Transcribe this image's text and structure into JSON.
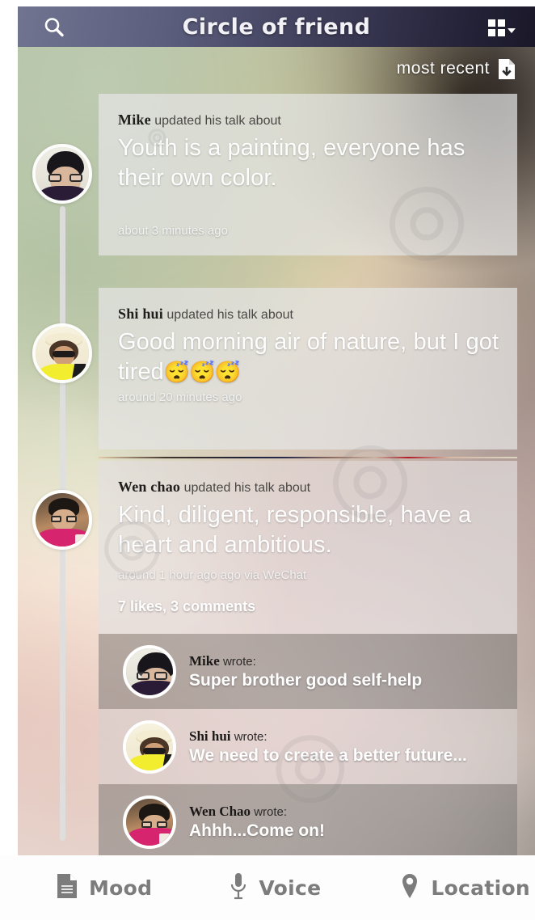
{
  "header": {
    "title": "Circle of friend",
    "search_icon": "search-icon",
    "grid_icon": "grid-menu-icon",
    "bar_color": "#3b3a55"
  },
  "sort": {
    "label": "most  recent",
    "icon": "document-download-icon"
  },
  "posts": [
    {
      "name": "Mike",
      "action": "updated his talk about",
      "message": "Youth is a painting, everyone has their own color.",
      "emoji": "",
      "time": "about 3 minutes ago",
      "avatar": "avatar-mike"
    },
    {
      "name": "Shi hui",
      "action": "updated his talk about",
      "message": "Good morning air of nature, but I got tired",
      "emoji": "😴😴😴",
      "time": "around 20 minutes ago",
      "avatar": "avatar-shi-hui"
    },
    {
      "name": "Wen chao",
      "action": "updated his talk about",
      "message": "Kind, diligent, responsible, have a heart and ambitious.",
      "emoji": "",
      "time": "around 1 hour ago ago via WeChat",
      "stats": "7 likes, 3 comments",
      "avatar": "avatar-wen-chao"
    }
  ],
  "comments": [
    {
      "name": "Mike",
      "action": "wrote:",
      "text": "Super brother good self-help",
      "avatar": "avatar-mike"
    },
    {
      "name": "Shi hui",
      "action": "wrote:",
      "text": "We need to create a better future...",
      "avatar": "avatar-shi-hui"
    },
    {
      "name": "Wen Chao",
      "action": "wrote:",
      "text": "Ahhh...Come on!",
      "avatar": "avatar-wen-chao"
    }
  ],
  "bottombar": [
    {
      "label": "Mood",
      "icon": "document-icon"
    },
    {
      "label": "Voice",
      "icon": "microphone-icon"
    },
    {
      "label": "Location",
      "icon": "location-pin-icon"
    }
  ],
  "colors": {
    "card_fill": "#e4e4e4",
    "bottom_label": "#7c7c7c",
    "accent_divider": "#1d2146"
  }
}
